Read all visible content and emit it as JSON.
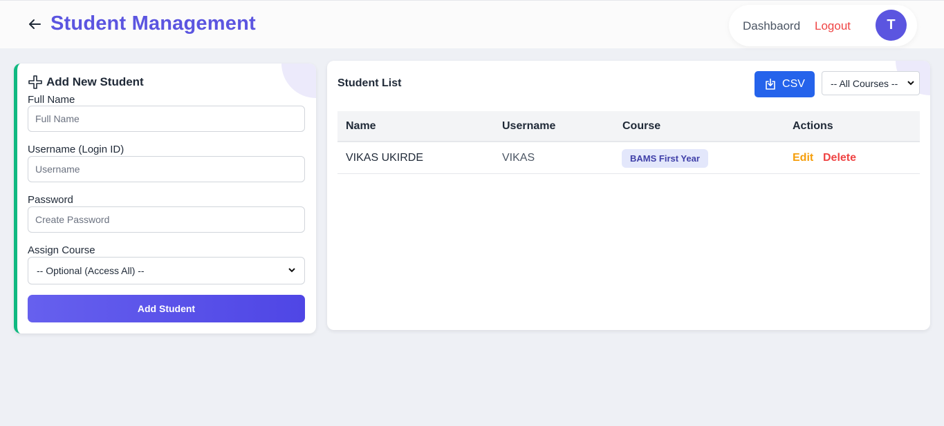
{
  "header": {
    "title": "Student Management",
    "nav_dashboard": "Dashbaord",
    "nav_logout": "Logout",
    "avatar_initial": "T"
  },
  "add_form": {
    "title": "Add New Student",
    "full_name_label": "Full Name",
    "full_name_placeholder": "Full Name",
    "username_label": "Username (Login ID)",
    "username_placeholder": "Username",
    "password_label": "Password",
    "password_placeholder": "Create Password",
    "course_label": "Assign Course",
    "course_selected": "-- Optional (Access All) --",
    "submit_label": "Add Student"
  },
  "student_list": {
    "title": "Student List",
    "csv_label": "CSV",
    "filter_selected": "-- All Courses --",
    "columns": [
      "Name",
      "Username",
      "Course",
      "Actions"
    ],
    "rows": [
      {
        "name": "VIKAS UKIRDE",
        "username": "VIKAS",
        "course": "BAMS First Year",
        "edit_label": "Edit",
        "delete_label": "Delete"
      }
    ]
  },
  "colors": {
    "brand": "#5b55e0",
    "accent_border": "#10b981",
    "csv_button": "#2563eb",
    "edit": "#f59e0b",
    "delete": "#ef4444"
  }
}
